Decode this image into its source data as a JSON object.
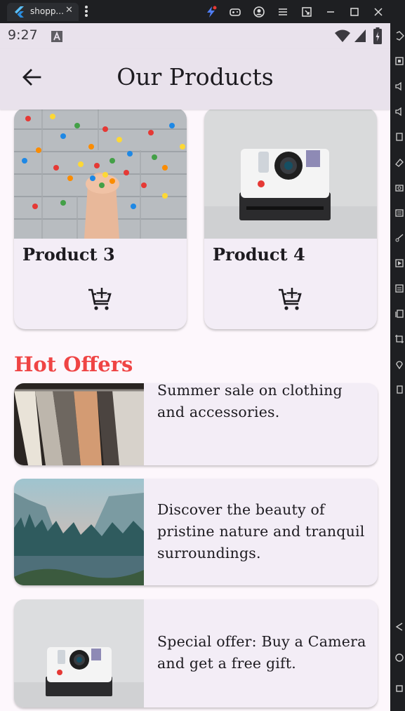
{
  "window": {
    "tab_title": "shopp...",
    "tab_close": "✕"
  },
  "statusbar": {
    "time": "9:27"
  },
  "appbar": {
    "title": "Our Products"
  },
  "products": [
    {
      "name": "Product 3",
      "image": "candy-hands-photo",
      "action_icon": "add-shopping-cart-icon"
    },
    {
      "name": "Product 4",
      "image": "polaroid-camera-photo",
      "action_icon": "add-shopping-cart-icon"
    }
  ],
  "hot_offers": {
    "title": "Hot Offers",
    "items": [
      {
        "text": "Summer sale on clothing and accessories.",
        "image": "clothing-rack-photo"
      },
      {
        "text": "Discover the beauty of pristine nature and tranquil surroundings.",
        "image": "mountain-lake-photo"
      },
      {
        "text": "Special offer: Buy a Camera and get a free gift.",
        "image": "camera-photo"
      }
    ]
  },
  "colors": {
    "accent": "#ef4444",
    "appbar_bg": "#e9e2ec",
    "page_bg": "#fdf7fc",
    "card_bg": "#f3edf6"
  }
}
